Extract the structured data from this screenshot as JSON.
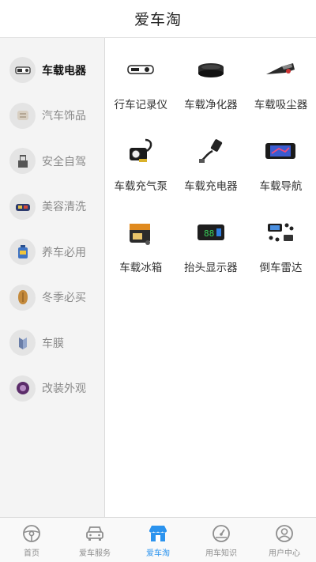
{
  "header": {
    "title": "爱车淘"
  },
  "sidebar": {
    "categories": [
      {
        "label": "车载电器",
        "icon": "dashcam-icon",
        "active": true
      },
      {
        "label": "汽车饰品",
        "icon": "car-ornament-icon",
        "active": false
      },
      {
        "label": "安全自驾",
        "icon": "safety-seat-icon",
        "active": false
      },
      {
        "label": "美容清洗",
        "icon": "car-wash-icon",
        "active": false
      },
      {
        "label": "养车必用",
        "icon": "engine-oil-icon",
        "active": false
      },
      {
        "label": "冬季必买",
        "icon": "winter-cushion-icon",
        "active": false
      },
      {
        "label": "车膜",
        "icon": "window-film-icon",
        "active": false
      },
      {
        "label": "改装外观",
        "icon": "modification-icon",
        "active": false
      }
    ]
  },
  "products": [
    {
      "label": "行车记录仪",
      "icon": "dash-recorder-icon"
    },
    {
      "label": "车载净化器",
      "icon": "air-purifier-icon"
    },
    {
      "label": "车载吸尘器",
      "icon": "vacuum-cleaner-icon"
    },
    {
      "label": "车载充气泵",
      "icon": "air-pump-icon"
    },
    {
      "label": "车载充电器",
      "icon": "car-charger-icon"
    },
    {
      "label": "车载导航",
      "icon": "gps-navigator-icon"
    },
    {
      "label": "车载冰箱",
      "icon": "car-fridge-icon"
    },
    {
      "label": "抬头显示器",
      "icon": "hud-display-icon"
    },
    {
      "label": "倒车雷达",
      "icon": "parking-radar-icon"
    }
  ],
  "tabbar": {
    "tabs": [
      {
        "label": "首页",
        "icon": "steering-wheel-icon",
        "active": false
      },
      {
        "label": "爱车服务",
        "icon": "car-service-icon",
        "active": false
      },
      {
        "label": "爱车淘",
        "icon": "shop-icon",
        "active": true
      },
      {
        "label": "用车知识",
        "icon": "gauge-icon",
        "active": false
      },
      {
        "label": "用户中心",
        "icon": "user-icon",
        "active": false
      }
    ]
  },
  "colors": {
    "accent": "#2b93ee",
    "sidebar_bg": "#f4f4f4",
    "inactive_text": "#8a8a8a"
  }
}
